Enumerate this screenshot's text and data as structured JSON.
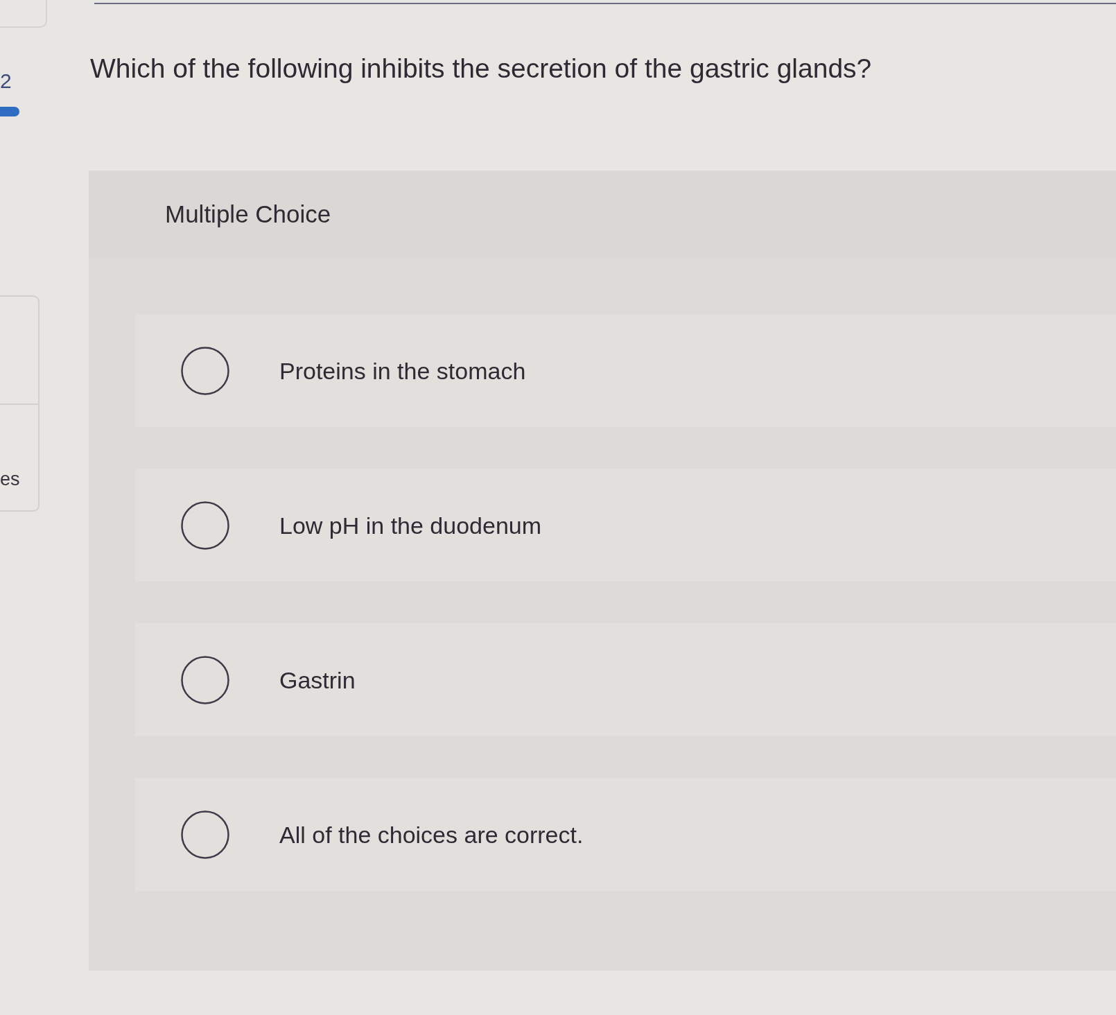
{
  "sidebar": {
    "question_number": "2",
    "panel_label": "es"
  },
  "question": "Which of the following inhibits the secretion of the gastric glands?",
  "answer_panel": {
    "type_label": "Multiple Choice",
    "options": [
      {
        "label": "Proteins in the stomach",
        "selected": false
      },
      {
        "label": "Low pH in the duodenum",
        "selected": false
      },
      {
        "label": "Gastrin",
        "selected": false
      },
      {
        "label": "All of the choices are correct.",
        "selected": false
      }
    ]
  }
}
